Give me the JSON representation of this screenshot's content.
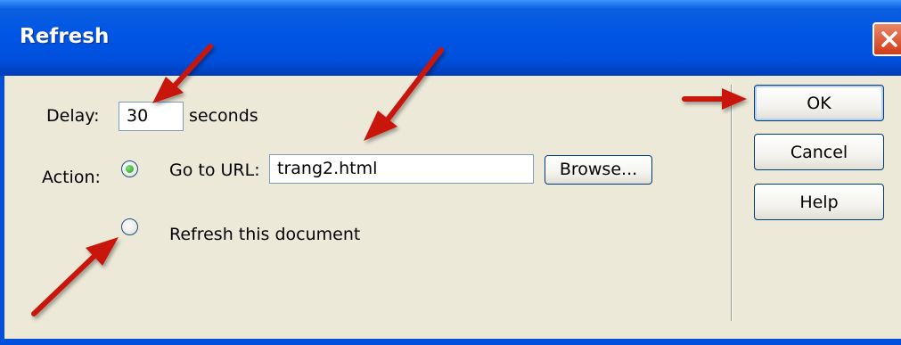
{
  "window": {
    "title": "Refresh"
  },
  "delay": {
    "label": "Delay:",
    "value": "30",
    "unit": "seconds"
  },
  "action": {
    "label": "Action:",
    "goto_label": "Go to URL:",
    "url_value": "trang2.html",
    "browse_label": "Browse...",
    "refresh_label": "Refresh this document",
    "selected": "goto"
  },
  "buttons": {
    "ok": "OK",
    "cancel": "Cancel",
    "help": "Help"
  },
  "icons": {
    "close": "close-icon",
    "annotation": "red-arrow-icon"
  },
  "colors": {
    "title_bar": "#0050DC",
    "dialog_bg": "#ECE9D8",
    "close_button": "#D23A15",
    "annotation": "#C8140F"
  }
}
